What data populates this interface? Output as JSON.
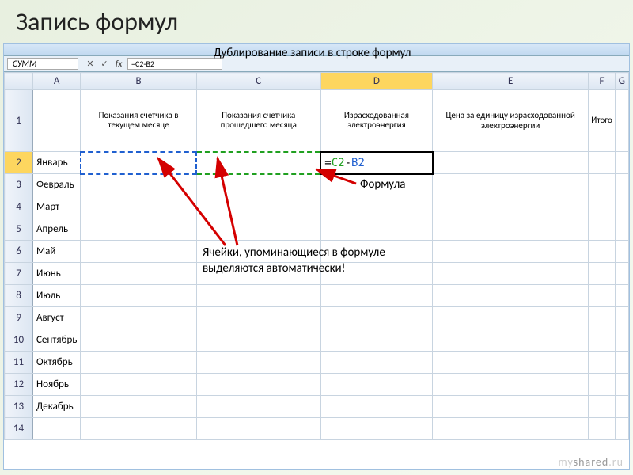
{
  "slide": {
    "title": "Запись формул"
  },
  "annotations": {
    "duplicate": "Дублирование записи в строке формул",
    "formula_label": "Формула",
    "cells_note_l1": "Ячейки, упоминающиеся в формуле",
    "cells_note_l2": "выделяются автоматически!"
  },
  "excel": {
    "name_box": "СУММ",
    "fb": {
      "cancel": "✕",
      "enter": "✓",
      "fx": "fx"
    },
    "formula_bar": "=C2-B2",
    "col_headers": [
      "A",
      "B",
      "C",
      "D",
      "E",
      "F",
      "G"
    ],
    "row_numbers": [
      "1",
      "2",
      "3",
      "4",
      "5",
      "6",
      "7",
      "8",
      "9",
      "10",
      "11",
      "12",
      "13",
      "14"
    ],
    "headers_row1": {
      "A": "",
      "B": "Показания счетчика в текущем месяце",
      "C": "Показания счетчика прошедшего месяца",
      "D": "Израсходованная электроэнергия",
      "E": "Цена за единицу израсходованной электроэнергии",
      "F": "Итого",
      "G": ""
    },
    "months": [
      "Январь",
      "Февраль",
      "Март",
      "Апрель",
      "Май",
      "Июнь",
      "Июль",
      "Август",
      "Сентябрь",
      "Октябрь",
      "Ноябрь",
      "Декабрь",
      ""
    ],
    "active_formula": {
      "eq": "=",
      "ref1": "C2",
      "op": "-",
      "ref2": "B2"
    }
  },
  "watermark": {
    "a": "my",
    "b": "shared",
    "c": ".ru"
  }
}
